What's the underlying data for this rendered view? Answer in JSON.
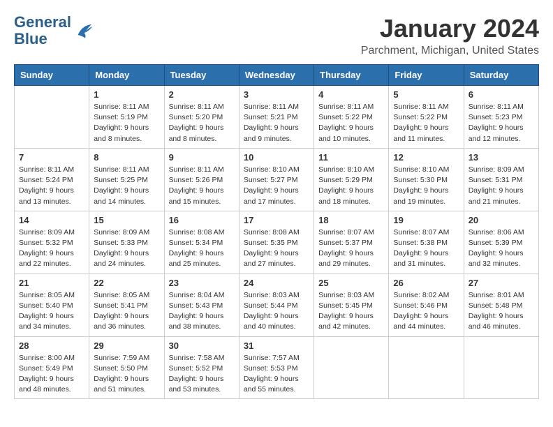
{
  "logo": {
    "line1": "General",
    "line2": "Blue"
  },
  "title": "January 2024",
  "location": "Parchment, Michigan, United States",
  "days_of_week": [
    "Sunday",
    "Monday",
    "Tuesday",
    "Wednesday",
    "Thursday",
    "Friday",
    "Saturday"
  ],
  "weeks": [
    [
      {
        "day": "",
        "sunrise": "",
        "sunset": "",
        "daylight": ""
      },
      {
        "day": "1",
        "sunrise": "Sunrise: 8:11 AM",
        "sunset": "Sunset: 5:19 PM",
        "daylight": "Daylight: 9 hours and 8 minutes."
      },
      {
        "day": "2",
        "sunrise": "Sunrise: 8:11 AM",
        "sunset": "Sunset: 5:20 PM",
        "daylight": "Daylight: 9 hours and 8 minutes."
      },
      {
        "day": "3",
        "sunrise": "Sunrise: 8:11 AM",
        "sunset": "Sunset: 5:21 PM",
        "daylight": "Daylight: 9 hours and 9 minutes."
      },
      {
        "day": "4",
        "sunrise": "Sunrise: 8:11 AM",
        "sunset": "Sunset: 5:22 PM",
        "daylight": "Daylight: 9 hours and 10 minutes."
      },
      {
        "day": "5",
        "sunrise": "Sunrise: 8:11 AM",
        "sunset": "Sunset: 5:22 PM",
        "daylight": "Daylight: 9 hours and 11 minutes."
      },
      {
        "day": "6",
        "sunrise": "Sunrise: 8:11 AM",
        "sunset": "Sunset: 5:23 PM",
        "daylight": "Daylight: 9 hours and 12 minutes."
      }
    ],
    [
      {
        "day": "7",
        "sunrise": "Sunrise: 8:11 AM",
        "sunset": "Sunset: 5:24 PM",
        "daylight": "Daylight: 9 hours and 13 minutes."
      },
      {
        "day": "8",
        "sunrise": "Sunrise: 8:11 AM",
        "sunset": "Sunset: 5:25 PM",
        "daylight": "Daylight: 9 hours and 14 minutes."
      },
      {
        "day": "9",
        "sunrise": "Sunrise: 8:11 AM",
        "sunset": "Sunset: 5:26 PM",
        "daylight": "Daylight: 9 hours and 15 minutes."
      },
      {
        "day": "10",
        "sunrise": "Sunrise: 8:10 AM",
        "sunset": "Sunset: 5:27 PM",
        "daylight": "Daylight: 9 hours and 17 minutes."
      },
      {
        "day": "11",
        "sunrise": "Sunrise: 8:10 AM",
        "sunset": "Sunset: 5:29 PM",
        "daylight": "Daylight: 9 hours and 18 minutes."
      },
      {
        "day": "12",
        "sunrise": "Sunrise: 8:10 AM",
        "sunset": "Sunset: 5:30 PM",
        "daylight": "Daylight: 9 hours and 19 minutes."
      },
      {
        "day": "13",
        "sunrise": "Sunrise: 8:09 AM",
        "sunset": "Sunset: 5:31 PM",
        "daylight": "Daylight: 9 hours and 21 minutes."
      }
    ],
    [
      {
        "day": "14",
        "sunrise": "Sunrise: 8:09 AM",
        "sunset": "Sunset: 5:32 PM",
        "daylight": "Daylight: 9 hours and 22 minutes."
      },
      {
        "day": "15",
        "sunrise": "Sunrise: 8:09 AM",
        "sunset": "Sunset: 5:33 PM",
        "daylight": "Daylight: 9 hours and 24 minutes."
      },
      {
        "day": "16",
        "sunrise": "Sunrise: 8:08 AM",
        "sunset": "Sunset: 5:34 PM",
        "daylight": "Daylight: 9 hours and 25 minutes."
      },
      {
        "day": "17",
        "sunrise": "Sunrise: 8:08 AM",
        "sunset": "Sunset: 5:35 PM",
        "daylight": "Daylight: 9 hours and 27 minutes."
      },
      {
        "day": "18",
        "sunrise": "Sunrise: 8:07 AM",
        "sunset": "Sunset: 5:37 PM",
        "daylight": "Daylight: 9 hours and 29 minutes."
      },
      {
        "day": "19",
        "sunrise": "Sunrise: 8:07 AM",
        "sunset": "Sunset: 5:38 PM",
        "daylight": "Daylight: 9 hours and 31 minutes."
      },
      {
        "day": "20",
        "sunrise": "Sunrise: 8:06 AM",
        "sunset": "Sunset: 5:39 PM",
        "daylight": "Daylight: 9 hours and 32 minutes."
      }
    ],
    [
      {
        "day": "21",
        "sunrise": "Sunrise: 8:05 AM",
        "sunset": "Sunset: 5:40 PM",
        "daylight": "Daylight: 9 hours and 34 minutes."
      },
      {
        "day": "22",
        "sunrise": "Sunrise: 8:05 AM",
        "sunset": "Sunset: 5:41 PM",
        "daylight": "Daylight: 9 hours and 36 minutes."
      },
      {
        "day": "23",
        "sunrise": "Sunrise: 8:04 AM",
        "sunset": "Sunset: 5:43 PM",
        "daylight": "Daylight: 9 hours and 38 minutes."
      },
      {
        "day": "24",
        "sunrise": "Sunrise: 8:03 AM",
        "sunset": "Sunset: 5:44 PM",
        "daylight": "Daylight: 9 hours and 40 minutes."
      },
      {
        "day": "25",
        "sunrise": "Sunrise: 8:03 AM",
        "sunset": "Sunset: 5:45 PM",
        "daylight": "Daylight: 9 hours and 42 minutes."
      },
      {
        "day": "26",
        "sunrise": "Sunrise: 8:02 AM",
        "sunset": "Sunset: 5:46 PM",
        "daylight": "Daylight: 9 hours and 44 minutes."
      },
      {
        "day": "27",
        "sunrise": "Sunrise: 8:01 AM",
        "sunset": "Sunset: 5:48 PM",
        "daylight": "Daylight: 9 hours and 46 minutes."
      }
    ],
    [
      {
        "day": "28",
        "sunrise": "Sunrise: 8:00 AM",
        "sunset": "Sunset: 5:49 PM",
        "daylight": "Daylight: 9 hours and 48 minutes."
      },
      {
        "day": "29",
        "sunrise": "Sunrise: 7:59 AM",
        "sunset": "Sunset: 5:50 PM",
        "daylight": "Daylight: 9 hours and 51 minutes."
      },
      {
        "day": "30",
        "sunrise": "Sunrise: 7:58 AM",
        "sunset": "Sunset: 5:52 PM",
        "daylight": "Daylight: 9 hours and 53 minutes."
      },
      {
        "day": "31",
        "sunrise": "Sunrise: 7:57 AM",
        "sunset": "Sunset: 5:53 PM",
        "daylight": "Daylight: 9 hours and 55 minutes."
      },
      {
        "day": "",
        "sunrise": "",
        "sunset": "",
        "daylight": ""
      },
      {
        "day": "",
        "sunrise": "",
        "sunset": "",
        "daylight": ""
      },
      {
        "day": "",
        "sunrise": "",
        "sunset": "",
        "daylight": ""
      }
    ]
  ]
}
